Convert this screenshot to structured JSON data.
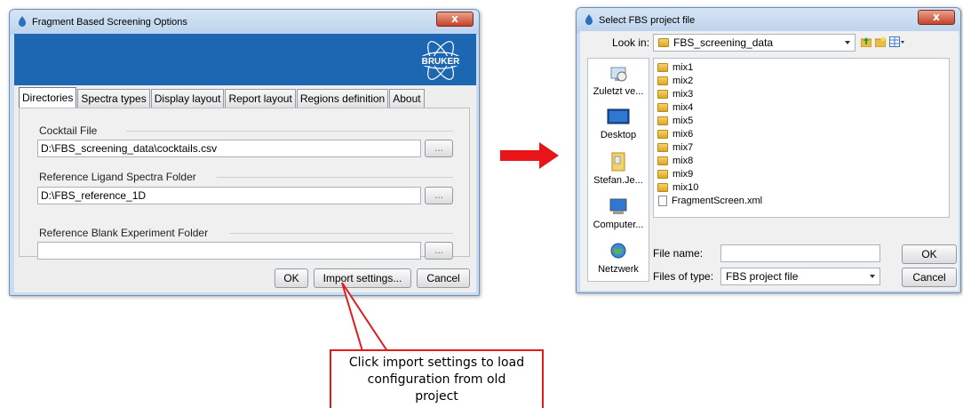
{
  "fbs_dialog": {
    "title": "Fragment Based Screening Options",
    "close_symbol": "x",
    "logo_text": "BRUKER",
    "tabs": [
      {
        "label": "Directories",
        "active": true
      },
      {
        "label": "Spectra types",
        "active": false
      },
      {
        "label": "Display layout",
        "active": false
      },
      {
        "label": "Report layout",
        "active": false
      },
      {
        "label": "Regions definition",
        "active": false
      },
      {
        "label": "About",
        "active": false
      }
    ],
    "cocktail_file": {
      "label": "Cocktail File",
      "value": "D:\\FBS_screening_data\\cocktails.csv",
      "browse": "..."
    },
    "reference_ligand": {
      "label": "Reference Ligand Spectra Folder",
      "value": "D:\\FBS_reference_1D",
      "browse": "..."
    },
    "reference_blank": {
      "label": "Reference Blank Experiment Folder",
      "value": "",
      "browse": "..."
    },
    "buttons": {
      "ok": "OK",
      "import": "Import settings...",
      "cancel": "Cancel"
    }
  },
  "file_dialog": {
    "title": "Select FBS project file",
    "close_symbol": "x",
    "look_in_label": "Look in:",
    "look_in_value": "FBS_screening_data",
    "places": [
      {
        "label": "Zuletzt ve...",
        "icon": "recent-icon"
      },
      {
        "label": "Desktop",
        "icon": "desktop-icon"
      },
      {
        "label": "Stefan.Je...",
        "icon": "user-folder-icon"
      },
      {
        "label": "Computer...",
        "icon": "computer-icon"
      },
      {
        "label": "Netzwerk",
        "icon": "network-icon"
      }
    ],
    "files": [
      {
        "name": "mix1",
        "type": "folder"
      },
      {
        "name": "mix2",
        "type": "folder"
      },
      {
        "name": "mix3",
        "type": "folder"
      },
      {
        "name": "mix4",
        "type": "folder"
      },
      {
        "name": "mix5",
        "type": "folder"
      },
      {
        "name": "mix6",
        "type": "folder"
      },
      {
        "name": "mix7",
        "type": "folder"
      },
      {
        "name": "mix8",
        "type": "folder"
      },
      {
        "name": "mix9",
        "type": "folder"
      },
      {
        "name": "mix10",
        "type": "folder"
      },
      {
        "name": "FragmentScreen.xml",
        "type": "file"
      }
    ],
    "file_name_label": "File name:",
    "file_name_value": "",
    "file_type_label": "Files of type:",
    "file_type_value": "FBS project file",
    "buttons": {
      "ok": "OK",
      "cancel": "Cancel"
    }
  },
  "callout": {
    "lines": [
      "Click import settings to load",
      "configuration from old",
      "project"
    ]
  },
  "colors": {
    "banner": "#1d66b1",
    "arrow": "#e8141a",
    "callout_border": "#e21b1b",
    "close_button": "#c7422a"
  }
}
